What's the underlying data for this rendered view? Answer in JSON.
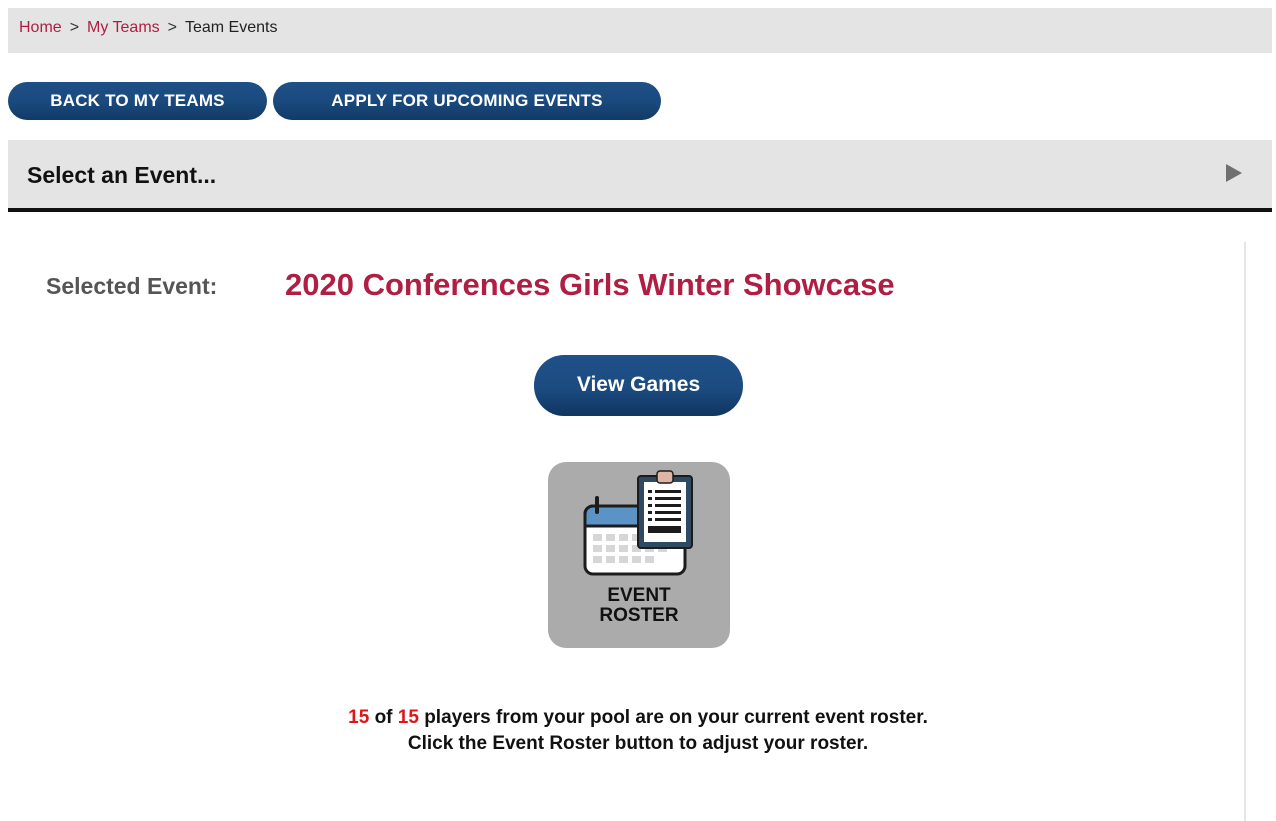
{
  "breadcrumb": {
    "home": "Home",
    "sep1": ">",
    "my_teams": "My Teams",
    "sep2": ">",
    "current": "Team Events"
  },
  "actions": {
    "back_label": "BACK TO MY TEAMS",
    "apply_label": "APPLY FOR UPCOMING EVENTS"
  },
  "event_selector": {
    "label": "Select an Event...",
    "icon": "triangle-right-icon"
  },
  "selected_event": {
    "label": "Selected Event:",
    "name": "2020 Conferences Girls Winter Showcase"
  },
  "view_games_label": "View Games",
  "roster_tile": {
    "line1": "EVENT",
    "line2": "ROSTER",
    "icon": "calendar-clipboard-icon"
  },
  "roster_info": {
    "on_roster": "15",
    "of_text": "of",
    "pool_total": "15",
    "rest_text": "players from your pool are on your current event roster.",
    "hint": "Click the Event Roster button to adjust your roster."
  },
  "colors": {
    "accent": "#b01e43",
    "button": "#1b4b80",
    "count": "#e01515"
  }
}
